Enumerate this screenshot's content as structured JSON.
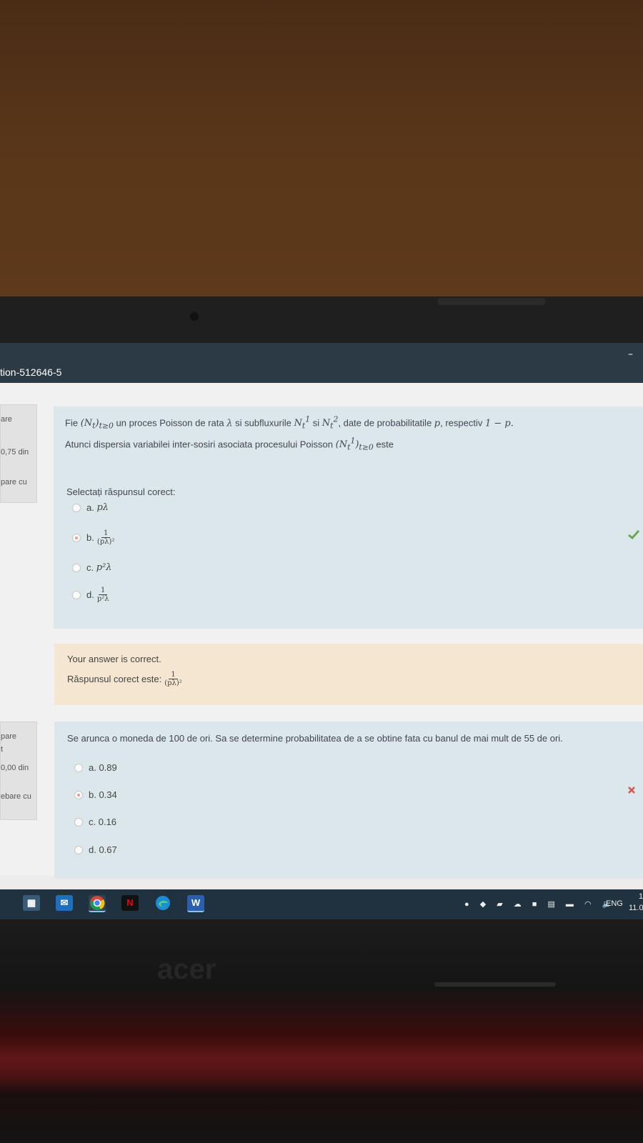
{
  "window": {
    "title": "tion-512646-5",
    "minimize": "–"
  },
  "question1": {
    "info": {
      "state": "are",
      "mark": "0,75 din",
      "flag": "pare cu"
    },
    "line1": {
      "pre": "Fie",
      "proc": "(N",
      "proc_sub": "t",
      "proc_close": ")",
      "proc_range": "t≥0",
      "mid": "un proces Poisson de rata",
      "lambda": "λ",
      "and1": "si subfluxurile",
      "n1": "N",
      "n1_sub": "t",
      "n1_sup": "1",
      "si": "si",
      "n2": "N",
      "n2_sub": "t",
      "n2_sup": "2",
      "post": ", date de probabilitatile",
      "p": "p",
      "resp": ", respectiv",
      "one_minus_p": "1 − p."
    },
    "line2": {
      "pre": "Atunci dispersia variabilei inter-sosiri asociata procesului Poisson",
      "proc": "(N",
      "proc_sub": "t",
      "proc_sup": "1",
      "proc_close": ")",
      "proc_range": "t≥0",
      "post": "este"
    },
    "prompt": "Selectați răspunsul corect:",
    "options": [
      {
        "letter": "a.",
        "math": "pλ"
      },
      {
        "letter": "b.",
        "num": "1",
        "den": "(pλ)²",
        "selected": true
      },
      {
        "letter": "c.",
        "math": "p²λ"
      },
      {
        "letter": "d.",
        "num": "1",
        "den": "p²λ"
      }
    ],
    "correct_icon": "check-icon",
    "feedback": {
      "status": "Your answer is correct.",
      "answer_label": "Răspunsul corect este:",
      "answer_num": "1",
      "answer_den": "(pλ)²"
    }
  },
  "question2": {
    "info": {
      "state": "pare",
      "t": "t",
      "mark": "0,00 din",
      "flag": "ebare cu"
    },
    "text": "Se arunca o moneda de 100 de ori. Sa se determine probabilitatea de a se obtine fata cu banul de mai mult de 55 de ori.",
    "options": [
      {
        "label": "a. 0.89"
      },
      {
        "label": "b. 0.34",
        "selected": true
      },
      {
        "label": "c. 0.16"
      },
      {
        "label": "d. 0.67"
      }
    ],
    "wrong_icon": "cross-icon"
  },
  "taskbar": {
    "apps": [
      "store-icon",
      "mail-icon",
      "chrome-icon",
      "netflix-icon",
      "edge-icon",
      "word-icon"
    ],
    "netflix": "N",
    "word": "W",
    "tray": {
      "lang": "ENG",
      "clock_top": "1",
      "clock_bottom": "11.0"
    }
  },
  "colors": {
    "check": "#6aa84f",
    "cross": "#d9534f",
    "question_bg": "#dbe7ea",
    "feedback_bg": "#f5e6d1"
  }
}
